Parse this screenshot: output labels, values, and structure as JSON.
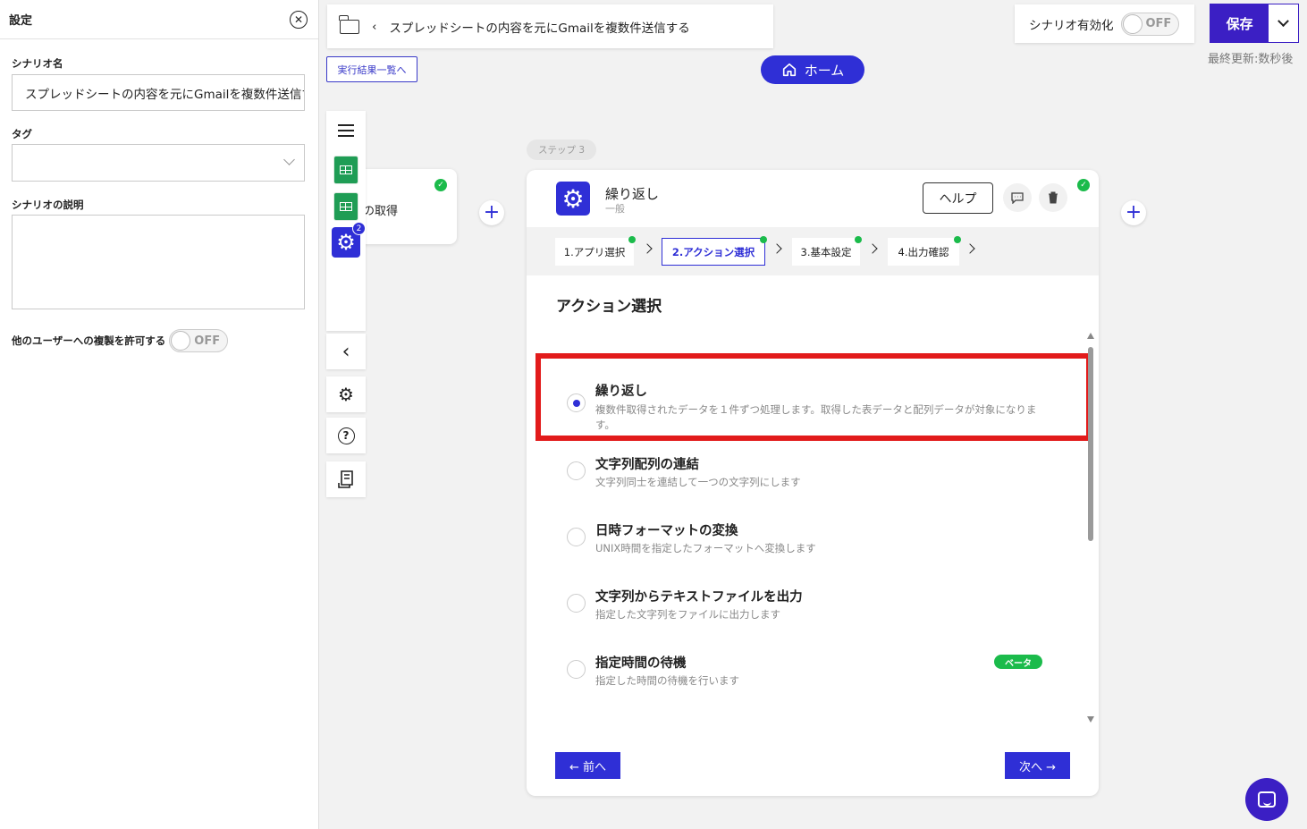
{
  "settings_panel": {
    "title": "設定",
    "scenario_name_label": "シナリオ名",
    "scenario_name_value": "スプレッドシートの内容を元にGmailを複数件送信する",
    "tag_label": "タグ",
    "tag_value": "",
    "description_label": "シナリオの説明",
    "description_value": "",
    "allow_copy_label": "他のユーザーへの複製を許可する",
    "allow_copy_state": "OFF"
  },
  "header": {
    "breadcrumb_back": "‹",
    "breadcrumb_title": "スプレッドシートの内容を元にGmailを複数件送信する",
    "run_results_label": "実行結果一覧へ",
    "home_label": "ホーム",
    "activate_label": "シナリオ有効化",
    "activate_state": "OFF",
    "save_label": "保存",
    "last_updated": "最終更新:数秒後"
  },
  "toolbar": {
    "badge_count": "2",
    "collapse_glyph": "‹",
    "settings_glyph": "⚙",
    "help_glyph": "?"
  },
  "behind_step": {
    "text": "の取得"
  },
  "step": {
    "step_label": "ステップ 3",
    "title": "繰り返し",
    "subtitle": "一般",
    "help_label": "ヘルプ",
    "tabs": [
      {
        "label": "1.アプリ選択"
      },
      {
        "label": "2.アクション選択"
      },
      {
        "label": "3.基本設定"
      },
      {
        "label": "4.出力確認"
      }
    ],
    "section_title": "アクション選択",
    "options": [
      {
        "title": "繰り返し",
        "desc": "複数件取得されたデータを１件ずつ処理します。取得した表データと配列データが対象になります。",
        "selected": true
      },
      {
        "title": "文字列配列の連結",
        "desc": "文字列同士を連結して一つの文字列にします",
        "selected": false
      },
      {
        "title": "日時フォーマットの変換",
        "desc": "UNIX時間を指定したフォーマットへ変換します",
        "selected": false
      },
      {
        "title": "文字列からテキストファイルを出力",
        "desc": "指定した文字列をファイルに出力します",
        "selected": false
      },
      {
        "title": "指定時間の待機",
        "desc": "指定した時間の待機を行います",
        "selected": false,
        "badge": "ベータ"
      }
    ],
    "prev_label": "← 前へ",
    "next_label": "次へ →"
  },
  "colors": {
    "primary": "#2f2fd6",
    "save": "#3b1fc4",
    "success": "#1bbb4b",
    "highlight": "#e21b1b"
  }
}
